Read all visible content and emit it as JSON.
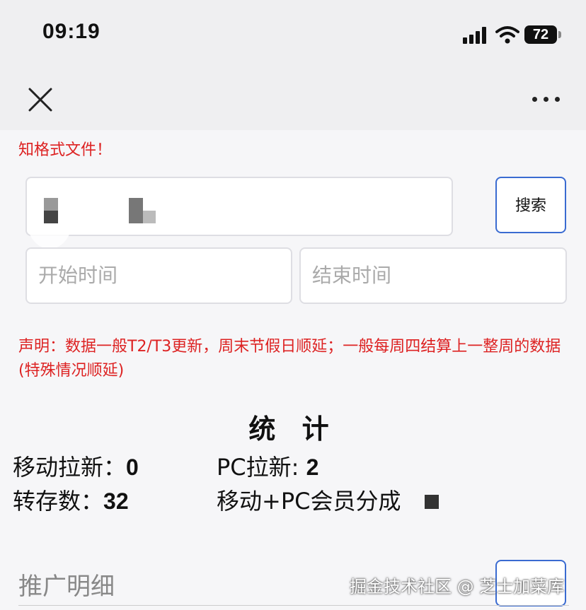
{
  "status_bar": {
    "time": "09:19",
    "battery": "72"
  },
  "page": {
    "warning_top": "知格式文件！",
    "search": {
      "button_label": "搜索"
    },
    "date_range": {
      "start_placeholder": "开始时间",
      "end_placeholder": "结束时间"
    },
    "notice": "声明：数据一般T2/T3更新，周末节假日顺延；一般每周四结算上一整周的数据(特殊情况顺延)",
    "stats": {
      "title": "统 计",
      "mobile_new_label": "移动拉新：",
      "mobile_new_value": "0",
      "pc_new_label": "PC拉新: ",
      "pc_new_value": "2",
      "saves_label": "转存数：",
      "saves_value": "32",
      "member_share_label": "移动+PC会员分成"
    },
    "detail": {
      "title": "推广明细"
    },
    "watermark": "掘金技术社区 @ 芝士加菜库"
  }
}
